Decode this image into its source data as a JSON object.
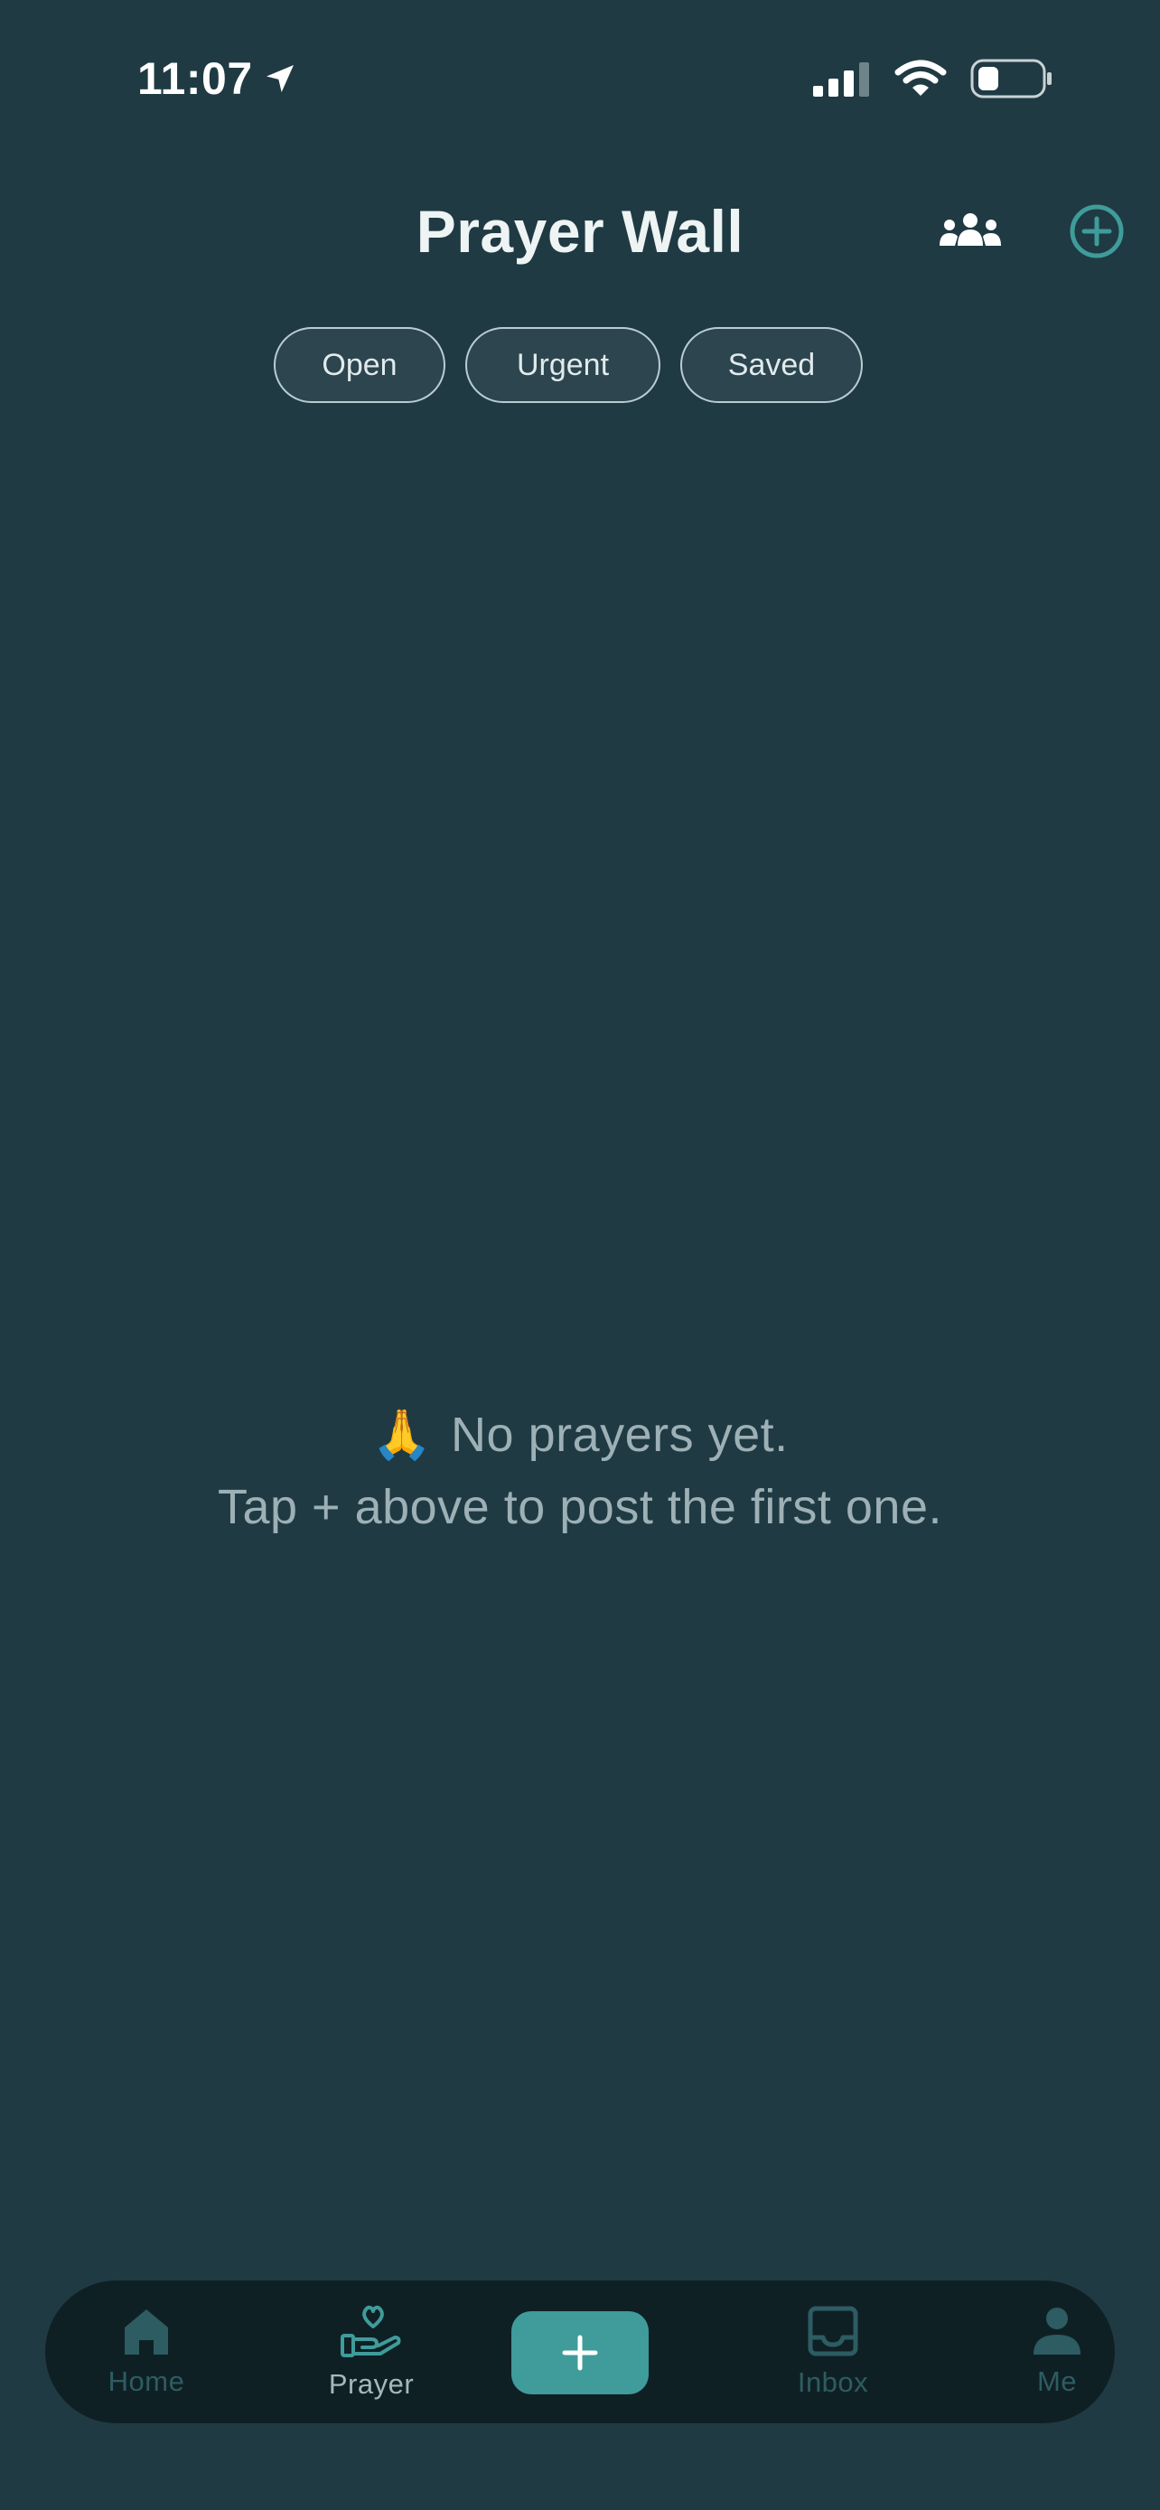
{
  "status_bar": {
    "time": "11:07"
  },
  "header": {
    "title": "Prayer Wall"
  },
  "filters": [
    {
      "label": "Open"
    },
    {
      "label": "Urgent"
    },
    {
      "label": "Saved"
    }
  ],
  "empty_state": {
    "emoji": "🙏",
    "line1": "No prayers yet.",
    "line2": "Tap + above to post the first one."
  },
  "tab_bar": {
    "home": "Home",
    "prayer": "Prayer",
    "inbox": "Inbox",
    "me": "Me",
    "active": "Prayer"
  },
  "colors": {
    "background": "#1f3a43",
    "accent": "#3f9c9a",
    "tabbar": "#0f2025",
    "inactive_icon": "#2d5c62",
    "active_label": "#a4b8bc"
  },
  "icons": {
    "header_left": "people-group-icon",
    "header_right": "plus-circle-icon",
    "tab_home": "home-icon",
    "tab_prayer": "hand-heart-icon",
    "tab_add": "plus-icon",
    "tab_inbox": "inbox-tray-icon",
    "tab_me": "person-icon"
  }
}
